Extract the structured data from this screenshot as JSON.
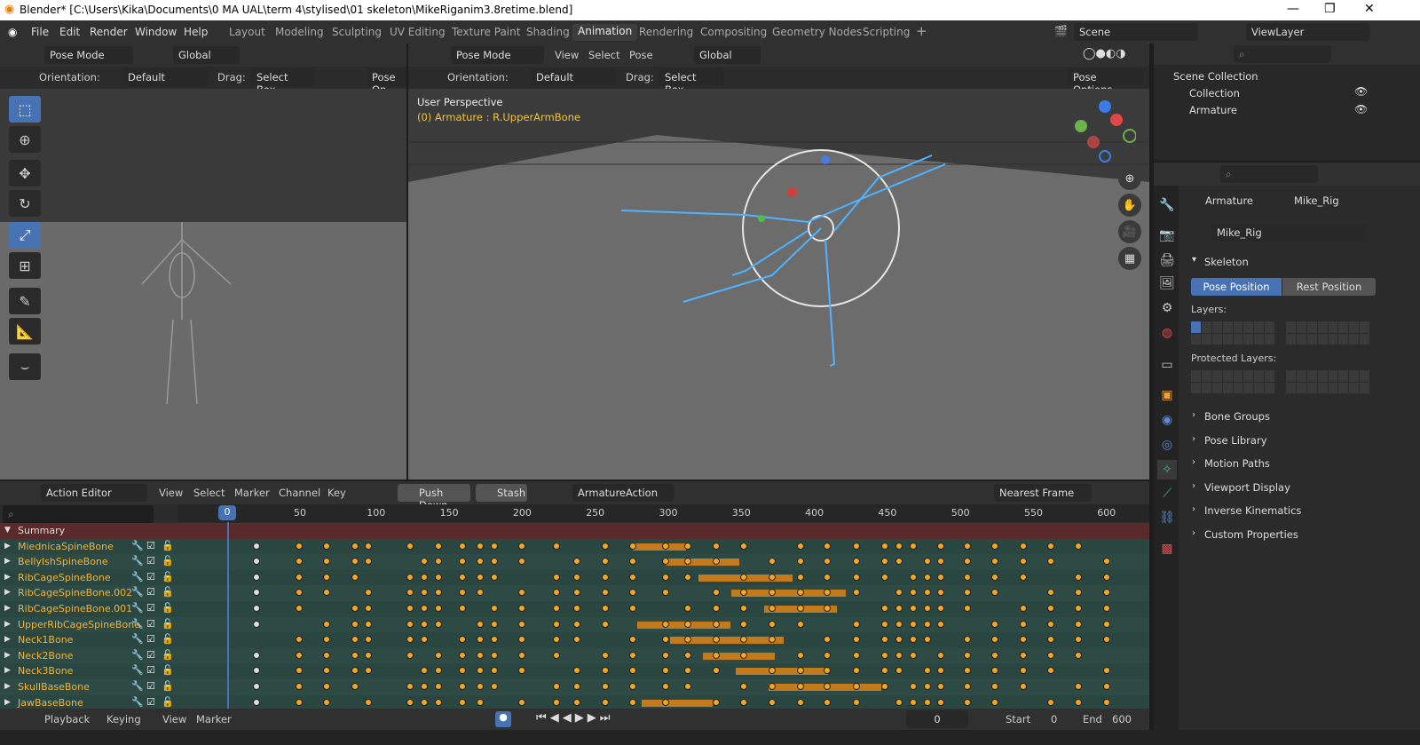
{
  "window": {
    "title": "Blender* [C:\\Users\\Kika\\Documents\\0 MA UAL\\term 4\\stylised\\01 skeleton\\MikeRiganim3.8retime.blend]"
  },
  "menu": [
    "File",
    "Edit",
    "Render",
    "Window",
    "Help"
  ],
  "workspaces": [
    "Layout",
    "Modeling",
    "Sculpting",
    "UV Editing",
    "Texture Paint",
    "Shading",
    "Animation",
    "Rendering",
    "Compositing",
    "Geometry Nodes",
    "Scripting"
  ],
  "scene": "Scene",
  "view_layer": "ViewLayer",
  "left_view": {
    "mode": "Pose Mode",
    "transform": "Global",
    "orientation_label": "Orientation:",
    "orientation": "Default",
    "drag_label": "Drag:",
    "drag": "Select Box",
    "pose_options": "Pose Op"
  },
  "main_view": {
    "mode": "Pose Mode",
    "menus": [
      "View",
      "Select",
      "Pose"
    ],
    "transform": "Global",
    "orientation_label": "Orientation:",
    "orientation": "Default",
    "drag_label": "Drag:",
    "drag": "Select Box",
    "pose_options": "Pose Options",
    "perspective": "User Perspective",
    "active": "(0) Armature : R.UpperArmBone"
  },
  "outliner": {
    "scene_collection": "Scene Collection",
    "items": [
      "Collection",
      "Armature"
    ]
  },
  "properties": {
    "breadcrumb_1": "Armature",
    "breadcrumb_2": "Mike_Rig",
    "data_name": "Mike_Rig",
    "skeleton": "Skeleton",
    "pose_position": "Pose Position",
    "rest_position": "Rest Position",
    "layers": "Layers:",
    "protected_layers": "Protected Layers:",
    "sections": [
      "Bone Groups",
      "Pose Library",
      "Motion Paths",
      "Viewport Display",
      "Inverse Kinematics",
      "Custom Properties"
    ]
  },
  "action_editor": {
    "editor": "Action Editor",
    "menus": [
      "View",
      "Select",
      "Marker",
      "Channel",
      "Key"
    ],
    "push_down": "Push Down",
    "stash": "Stash",
    "action": "ArmatureAction",
    "snap": "Nearest Frame",
    "current_frame": "0",
    "ruler": [
      "50",
      "100",
      "150",
      "200",
      "250",
      "300",
      "350",
      "400",
      "450",
      "500",
      "550",
      "600"
    ],
    "summary": "Summary",
    "channels": [
      "MiednicaSpineBone",
      "BellyIshSpineBone",
      "RibCageSpineBone",
      "RibCageSpineBone.002",
      "RibCageSpineBone.001",
      "UpperRibCageSpineBone",
      "Neck1Bone",
      "Neck2Bone",
      "Neck3Bone",
      "SkullBaseBone",
      "JawBaseBone"
    ]
  },
  "timeline": {
    "playback": "Playback",
    "keying": "Keying",
    "view": "View",
    "marker": "Marker",
    "frame": "0",
    "start_label": "Start",
    "start": "0",
    "end_label": "End",
    "end": "600"
  }
}
